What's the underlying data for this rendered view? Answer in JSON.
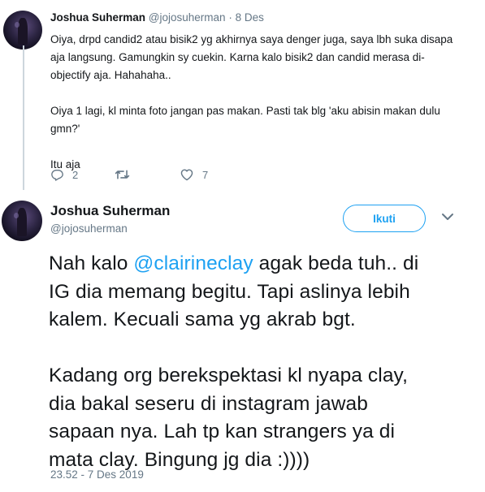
{
  "tweet1": {
    "name": "Joshua Suherman",
    "handle": "@jojosuherman",
    "separator": "·",
    "date": "8 Des",
    "lines": [
      "Oiya, drpd candid2 atau bisik2 yg akhirnya saya denger juga, saya lbh suka disapa",
      "aja langsung. Gamungkin sy cuekin. Karna kalo bisik2 dan candid merasa di-",
      "objectify aja. Hahahaha..",
      "",
      "Oiya 1 lagi, kl minta foto jangan pas makan. Pasti tak blg 'aku abisin makan dulu",
      "gmn?'",
      "",
      "Itu aja"
    ],
    "actions": {
      "reply_count": "2",
      "retweet_count": "",
      "like_count": "7"
    }
  },
  "tweet2": {
    "name": "Joshua Suherman",
    "handle": "@jojosuherman",
    "follow_label": "Ikuti",
    "line1_pre": "Nah kalo ",
    "mention": "@clairineclay",
    "line1_post": " agak beda tuh.. di",
    "lines": [
      "IG dia memang begitu. Tapi aslinya lebih",
      "kalem. Kecuali sama yg akrab bgt.",
      "",
      "Kadang org berekspektasi kl nyapa clay,",
      "dia bakal seseru di instagram jawab",
      "sapaan nya. Lah tp kan strangers ya di",
      "mata clay. Bingung jg dia :))))"
    ],
    "timestamp": "23.52 - 7 Des 2019"
  },
  "colors": {
    "accent": "#1da1f2",
    "secondary_text": "#657786",
    "primary_text": "#14171a",
    "thread_line": "#cdd6dd"
  },
  "icons": [
    "reply-icon",
    "retweet-icon",
    "like-icon",
    "chevron-down-icon"
  ]
}
